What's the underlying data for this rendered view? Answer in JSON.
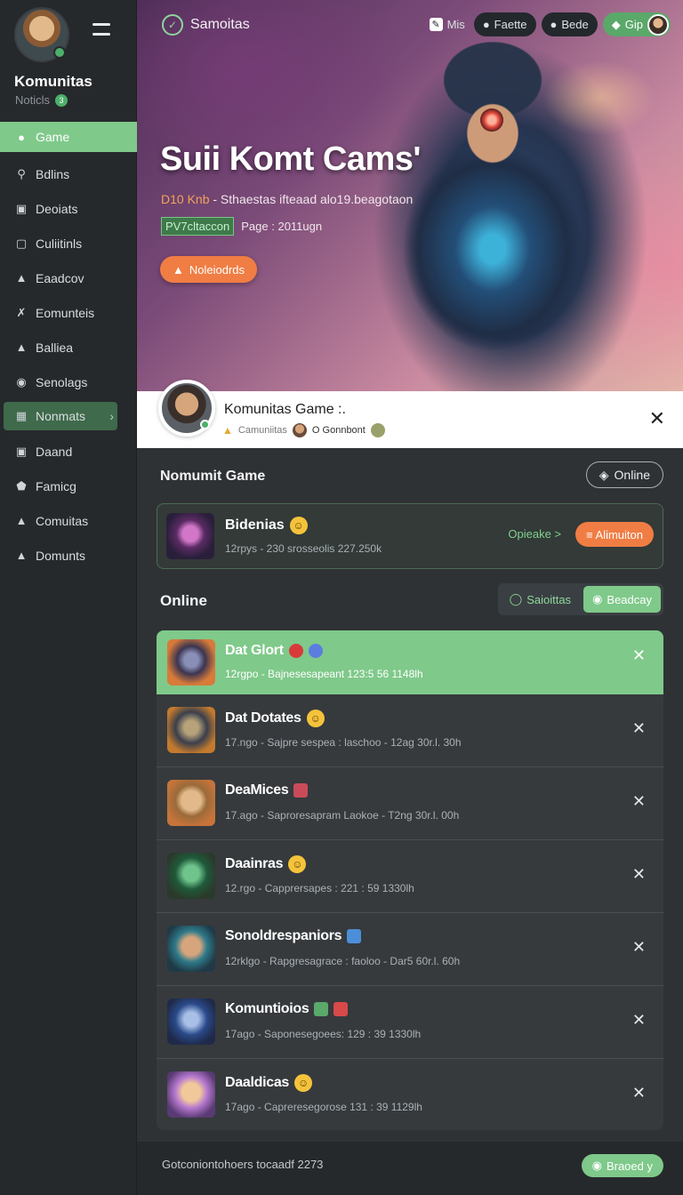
{
  "sidebar": {
    "title": "Komunitas",
    "subtitle": "Noticls",
    "subtitle_count": "3",
    "items": [
      {
        "label": "Game",
        "icon": "user-icon"
      },
      {
        "label": "Bdlins",
        "icon": "search-icon"
      },
      {
        "label": "Deoiats",
        "icon": "square-icon"
      },
      {
        "label": "Culiitinls",
        "icon": "square-icon"
      },
      {
        "label": "Eaadcov",
        "icon": "user-icon"
      },
      {
        "label": "Eomunteis",
        "icon": "handshake-icon"
      },
      {
        "label": "Balliea",
        "icon": "house-icon"
      },
      {
        "label": "Senolags",
        "icon": "globe-icon"
      },
      {
        "label": "Nonmats",
        "icon": "grid-icon"
      },
      {
        "label": "Daand",
        "icon": "square-icon"
      },
      {
        "label": "Famicg",
        "icon": "shield-icon"
      },
      {
        "label": "Comuitas",
        "icon": "controller-icon"
      },
      {
        "label": "Domunts",
        "icon": "user-icon"
      }
    ]
  },
  "hero": {
    "brand": "Samoitas",
    "top_actions": [
      {
        "label": "Mis"
      },
      {
        "label": "Faette"
      },
      {
        "label": "Bede"
      },
      {
        "label": "Gip"
      }
    ],
    "title": "Suii Komt Cams'",
    "meta_accent": "D10 Knb",
    "meta_rest": "- Sthaestas ifteaad alo19.beagotaon",
    "tag": "PV7cltaccon",
    "tag_note": "Page : 2011ugn",
    "button": "Noleiodrds"
  },
  "profile": {
    "name": "Komunitas Game :.",
    "sub_a": "Camuniitas",
    "sub_b": "O Gonnbont"
  },
  "section1": {
    "title": "Nomumit Game",
    "online_label": "Online",
    "feature": {
      "name": "Bidenias",
      "meta": "12rpys - 230 srosseolis 227.250k",
      "option": "Opieake >",
      "button": "≡ Alimuiton"
    }
  },
  "section2": {
    "title": "Online",
    "seg_a": "Saioittas",
    "seg_b": "Beadcay"
  },
  "list": [
    {
      "name": "Dat Glort",
      "meta": "12rgpo - Bajnesesapeant 123:5 56 1148lh",
      "badges": [
        "#d83a3a",
        "#5b7de0"
      ]
    },
    {
      "name": "Dat Dotates",
      "meta": "17.ngo - Sajpre sespea : laschoo - 12ag 30r.l. 30h",
      "badges": [
        "emoji"
      ]
    },
    {
      "name": "DeaMices",
      "meta": "17.ago - Saproresapram Laokoe - T2ng 30r.l. 00h",
      "badges": [
        "#c94b5a"
      ]
    },
    {
      "name": "Daainras",
      "meta": "12.rgo - Capprersapes : 221 : 59 1330lh",
      "badges": [
        "emoji"
      ]
    },
    {
      "name": "Sonoldrespaniors",
      "meta": "12rklgo - Rapgresagrace : faoloo - Dar5 60r.l. 60h",
      "badges": [
        "#4c8fd8"
      ]
    },
    {
      "name": "Komuntioios",
      "meta": "17ago - Saponesegoees: 129 : 39 1330lh",
      "badges": [
        "#5aa86a",
        "#d8494a"
      ]
    },
    {
      "name": "Daaldicas",
      "meta": "17ago - Capreresegorose 131 : 39 1129lh",
      "badges": [
        "emoji"
      ]
    }
  ],
  "footer": {
    "text": "Gotconiontohoers tocaadf 2273",
    "button": "Braoed y"
  }
}
